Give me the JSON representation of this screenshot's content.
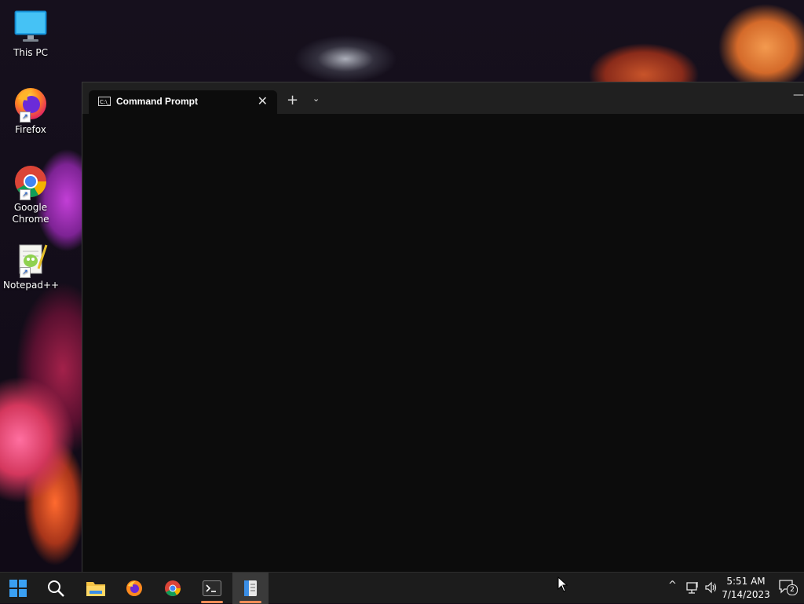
{
  "desktop": {
    "icons": [
      {
        "label": "This PC",
        "icon": "monitor-icon"
      },
      {
        "label": "Firefox",
        "icon": "firefox-icon"
      },
      {
        "label": "Google Chrome",
        "icon": "chrome-icon"
      },
      {
        "label": "Notepad++",
        "icon": "notepadpp-icon"
      }
    ]
  },
  "terminal": {
    "tab_label": "Command Prompt",
    "tab_icon_text": "C:\\_",
    "close_glyph": "✕",
    "new_tab_glyph": "+",
    "dropdown_glyph": "⌄",
    "minimize_glyph": "—"
  },
  "taskbar": {
    "apps": [
      {
        "name": "start",
        "icon": "windows-logo-icon"
      },
      {
        "name": "search",
        "icon": "search-icon"
      },
      {
        "name": "file-explorer",
        "icon": "folder-icon"
      },
      {
        "name": "firefox",
        "icon": "firefox-icon"
      },
      {
        "name": "chrome",
        "icon": "chrome-icon"
      },
      {
        "name": "terminal",
        "icon": "terminal-icon",
        "running": true
      },
      {
        "name": "notepad",
        "icon": "notepad-icon",
        "running": true,
        "active": true
      }
    ],
    "tray": {
      "chevron_glyph": "^",
      "time": "5:51 AM",
      "date": "7/14/2023",
      "notification_count": "2"
    }
  },
  "colors": {
    "accent": "#f08c57",
    "terminal_bg": "#0c0c0c",
    "tabbar_bg": "#202020",
    "taskbar_bg": "#1c1c1c"
  }
}
